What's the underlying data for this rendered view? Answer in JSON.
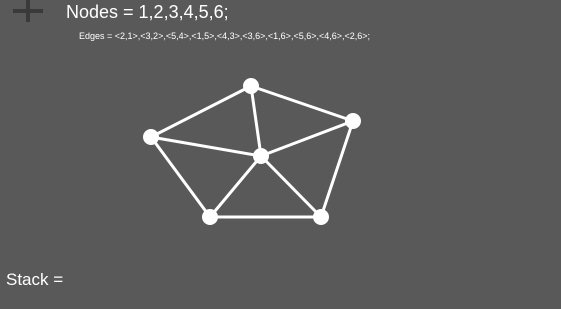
{
  "toolbar": {
    "add_icon": "plus-icon"
  },
  "header": {
    "nodes_text": "Nodes = 1,2,3,4,5,6;",
    "edges_text": "Edges = <2,1>,<3,2>,<5,4>,<1,5>,<4,3>,<3,6>,<1,6>,<5,6>,<4,6>,<2,6>;"
  },
  "graph": {
    "nodes": [
      1,
      2,
      3,
      4,
      5,
      6
    ],
    "edges": [
      [
        2,
        1
      ],
      [
        3,
        2
      ],
      [
        5,
        4
      ],
      [
        1,
        5
      ],
      [
        4,
        3
      ],
      [
        3,
        6
      ],
      [
        1,
        6
      ],
      [
        5,
        6
      ],
      [
        4,
        6
      ],
      [
        2,
        6
      ]
    ],
    "node_color": "#ffffff",
    "edge_color": "#ffffff"
  },
  "footer": {
    "stack_text": "Stack ="
  },
  "colors": {
    "background": "#595959",
    "icon": "#3a3a3a",
    "text": "#ffffff"
  }
}
